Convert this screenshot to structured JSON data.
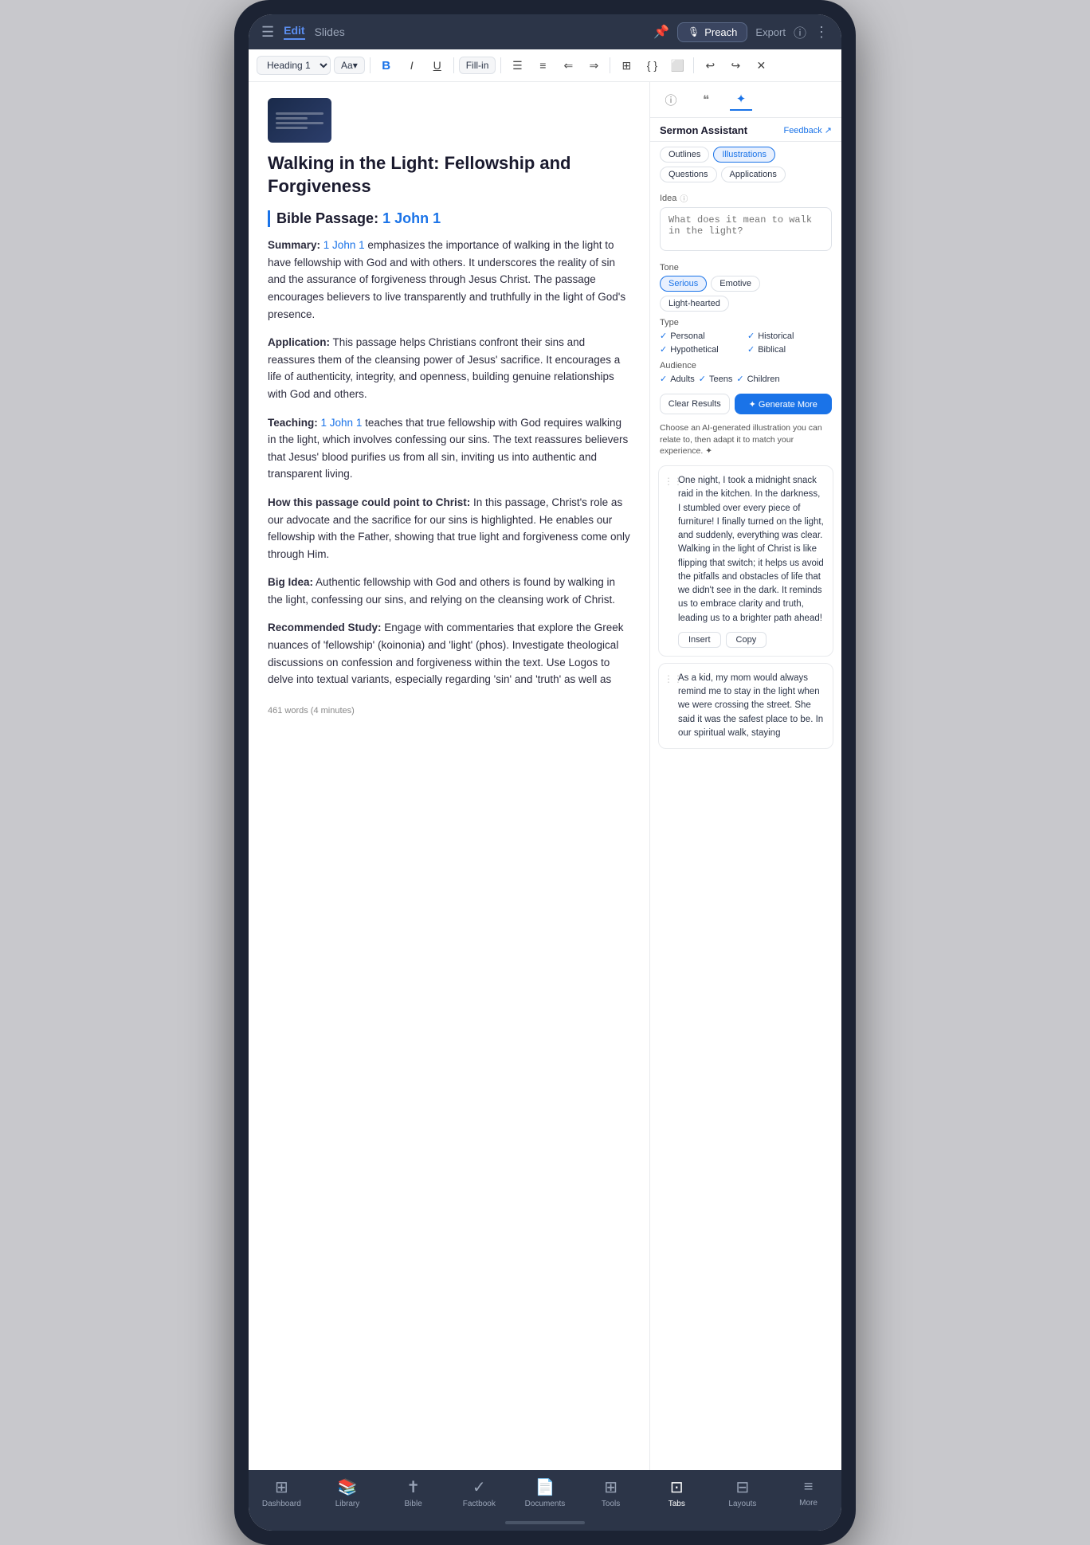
{
  "device": {
    "topbar": {
      "hamburger": "☰",
      "tabs": {
        "edit": "Edit",
        "slides": "Slides"
      },
      "preach": "Preach",
      "export": "Export",
      "info": "ⓘ",
      "more": "⋮"
    }
  },
  "toolbar": {
    "heading_select": "Heading 1",
    "font_size": "Aa",
    "bold": "B",
    "italic": "I",
    "underline": "U",
    "fill_in": "Fill-in",
    "undo": "↩",
    "redo": "↪",
    "close": "✕"
  },
  "editor": {
    "thumb_alt": "sermon thumbnail",
    "title": "Walking in the Light: Fellowship and Forgiveness",
    "bible_passage_label": "Bible Passage:",
    "bible_ref": "1 John 1",
    "sections": [
      {
        "label": "Summary:",
        "ref": "1 John 1",
        "text": " emphasizes the importance of walking in the light to have fellowship with God and with others. It underscores the reality of sin and the assurance of forgiveness through Jesus Christ. The passage encourages believers to live transparently and truthfully in the light of God's presence."
      },
      {
        "label": "Application:",
        "text": " This passage helps Christians confront their sins and reassures them of the cleansing power of Jesus' sacrifice. It encourages a life of authenticity, integrity, and openness, building genuine relationships with God and others."
      },
      {
        "label": "Teaching:",
        "ref": "1 John 1",
        "text": " teaches that true fellowship with God requires walking in the light, which involves confessing our sins. The text reassures believers that Jesus' blood purifies us from all sin, inviting us into authentic and transparent living."
      },
      {
        "label": "How this passage could point to Christ:",
        "text": " In this passage, Christ's role as our advocate and the sacrifice for our sins is highlighted. He enables our fellowship with the Father, showing that true light and forgiveness come only through Him."
      },
      {
        "label": "Big Idea:",
        "text": " Authentic fellowship with God and others is found by walking in the light, confessing our sins, and relying on the cleansing work of Christ."
      },
      {
        "label": "Recommended Study:",
        "text": " Engage with commentaries that explore the Greek nuances of 'fellowship' (koinonia) and 'light' (phos). Investigate theological discussions on confession and forgiveness within the text. Use Logos to delve into textual variants, especially regarding 'sin' and 'truth' as well as"
      }
    ],
    "word_count": "461 words (4 minutes)"
  },
  "sidebar": {
    "icons": {
      "info": "ⓘ",
      "quote": "❝",
      "sparkle": "✦"
    },
    "header": {
      "title": "Sermon Assistant",
      "feedback": "Feedback",
      "feedback_icon": "↗"
    },
    "tabs": [
      "Outlines",
      "Illustrations",
      "Questions",
      "Applications"
    ],
    "idea": {
      "label": "Idea",
      "info": "?",
      "placeholder": "What does it mean to walk in the light?"
    },
    "tone": {
      "label": "Tone",
      "options": [
        "Serious",
        "Emotive",
        "Light-hearted"
      ]
    },
    "type": {
      "label": "Type",
      "options": [
        {
          "label": "Personal",
          "checked": true
        },
        {
          "label": "Historical",
          "checked": true
        },
        {
          "label": "Hypothetical",
          "checked": true
        },
        {
          "label": "Biblical",
          "checked": true
        }
      ]
    },
    "audience": {
      "label": "Audience",
      "options": [
        {
          "label": "Adults",
          "checked": true
        },
        {
          "label": "Teens",
          "checked": true
        },
        {
          "label": "Children",
          "checked": true
        }
      ]
    },
    "clear_btn": "Clear Results",
    "generate_btn": "✦ Generate More",
    "ai_hint": "Choose an AI-generated illustration you can relate to, then adapt it to match your experience. ✦",
    "illustrations": [
      {
        "text": "One night, I took a midnight snack raid in the kitchen. In the darkness, I stumbled over every piece of furniture! I finally turned on the light, and suddenly, everything was clear. Walking in the light of Christ is like flipping that switch; it helps us avoid the pitfalls and obstacles of life that we didn't see in the dark. It reminds us to embrace clarity and truth, leading us to a brighter path ahead!",
        "insert": "Insert",
        "copy": "Copy"
      },
      {
        "text": "As a kid, my mom would always remind me to stay in the light when we were crossing the street. She said it was the safest place to be. In our spiritual walk, staying",
        "insert": "Insert",
        "copy": "Copy"
      }
    ]
  },
  "bottom_nav": {
    "items": [
      {
        "icon": "⊞",
        "label": "Dashboard",
        "active": false
      },
      {
        "icon": "📚",
        "label": "Library",
        "active": false
      },
      {
        "icon": "✝",
        "label": "Bible",
        "active": false
      },
      {
        "icon": "✓",
        "label": "Factbook",
        "active": false
      },
      {
        "icon": "📄",
        "label": "Documents",
        "active": false
      },
      {
        "icon": "⊞",
        "label": "Tools",
        "active": false
      },
      {
        "icon": "⊡",
        "label": "Tabs",
        "active": true
      },
      {
        "icon": "⊟",
        "label": "Layouts",
        "active": false
      },
      {
        "icon": "≡",
        "label": "More",
        "active": false
      }
    ]
  }
}
